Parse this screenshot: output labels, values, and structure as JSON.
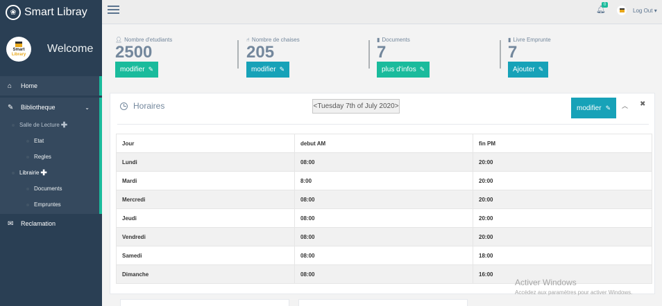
{
  "brand": {
    "title": "Smart Libray",
    "icon": "paw-icon"
  },
  "profile": {
    "welcome": "Welcome",
    "logo_line1": "Smart",
    "logo_line2": "Library"
  },
  "sidebar": {
    "home": "Home",
    "bibliotheque": "Bibliotheque",
    "salle": "Salle de Lecture",
    "etat": "Etat",
    "regles": "Regles",
    "librairie": "Librairie",
    "documents": "Documents",
    "empruntes": "Empruntes",
    "reclamation": "Reclamation"
  },
  "topbar": {
    "badge": "0",
    "logout": "Log Out"
  },
  "tiles": [
    {
      "label": "Nombre d'etudiants",
      "value": "2500",
      "button": "modifier"
    },
    {
      "label": "Nombre de chaises",
      "value": "205",
      "button": "modifier"
    },
    {
      "label": "Documents",
      "value": "7",
      "button": "plus d'infos"
    },
    {
      "label": "Livre Emprunte",
      "value": "7",
      "button": "Ajouter"
    }
  ],
  "panel": {
    "title": "Horaires",
    "date": "Tuesday 7th of July 2020",
    "date_prev": "<",
    "date_next": ">",
    "button": "modifier"
  },
  "table": {
    "headers": [
      "Jour",
      "debut AM",
      "fin PM"
    ],
    "rows": [
      [
        "Lundi",
        "08:00",
        "20:00"
      ],
      [
        "Mardi",
        "8:00",
        "20:00"
      ],
      [
        "Mercredi",
        "08:00",
        "20:00"
      ],
      [
        "Jeudi",
        "08:00",
        "20:00"
      ],
      [
        "Vendredi",
        "08:00",
        "20:00"
      ],
      [
        "Samedi",
        "08:00",
        "18:00"
      ],
      [
        "Dimanche",
        "08:00",
        "16:00"
      ]
    ]
  },
  "watermark": {
    "line1": "Activer Windows",
    "line2": "Accédez aux paramètres pour activer Windows."
  },
  "colors": {
    "sidebar": "#2a3f54",
    "accent": "#1abb9c",
    "info": "#17a2b8"
  }
}
